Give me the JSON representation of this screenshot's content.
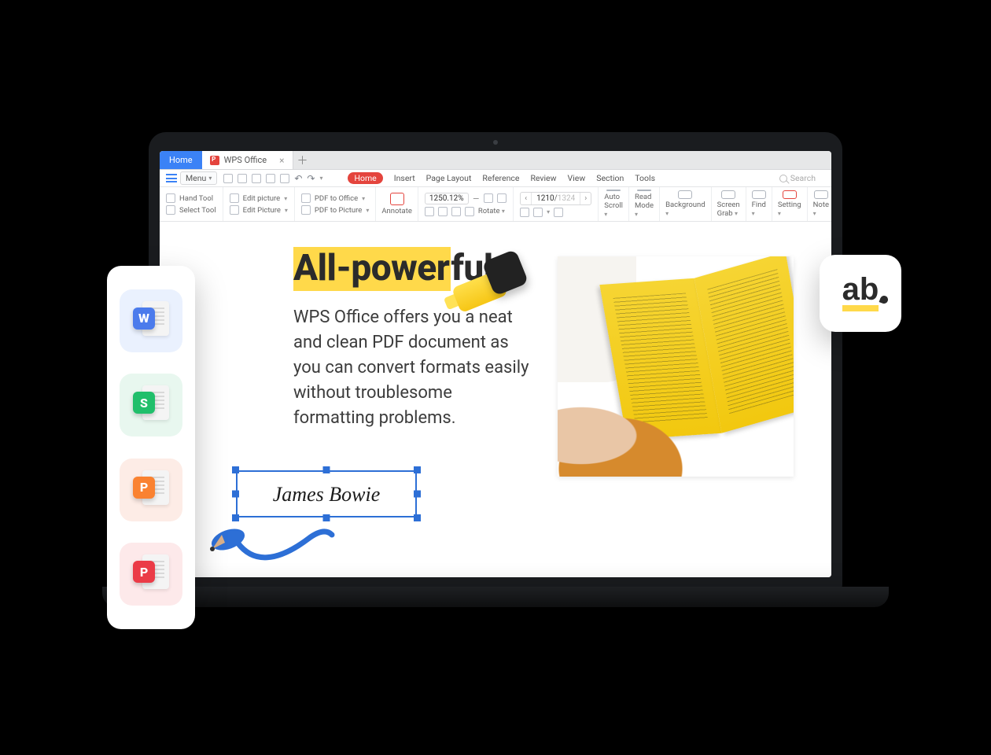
{
  "tabs": {
    "home": "Home",
    "doc": "WPS Office"
  },
  "menu": {
    "label": "Menu"
  },
  "ribbonTabs": [
    "Home",
    "Insert",
    "Page Layout",
    "Reference",
    "Review",
    "View",
    "Section",
    "Tools"
  ],
  "search": {
    "placeholder": "Search"
  },
  "tools": {
    "hand": "Hand Tool",
    "select": "Select Tool",
    "editPicLower": "Edit picture",
    "editPicUpper": "Edit Picture",
    "pdfToOffice": "PDF to Office",
    "pdfToPicture": "PDF to Picture",
    "annotate": "Annotate",
    "rotate": "Rotate",
    "zoom": "1250.12%",
    "page": {
      "current": "1210",
      "total": "1324"
    },
    "autoScroll": "Auto Scroll",
    "readMode": "Read Mode",
    "background": "Background",
    "screenGrab": "Screen Grab",
    "find": "Find",
    "setting": "Setting",
    "note": "Note"
  },
  "content": {
    "headline_hl": "All-power",
    "headline_rest": "ful",
    "body": "WPS Office offers you a neat and clean PDF document as you can convert formats easily without troublesome formatting problems.",
    "signature": "James Bowie"
  },
  "formats": {
    "w": "W",
    "s": "S",
    "p": "P",
    "pdf": "P"
  },
  "ab": "ab"
}
